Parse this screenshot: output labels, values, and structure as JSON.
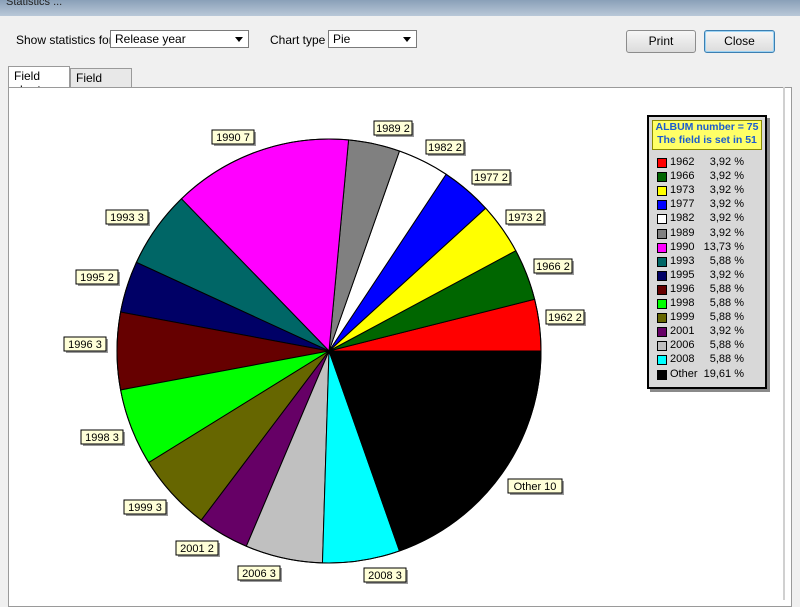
{
  "window": {
    "title": "Statistics ..."
  },
  "toolbar": {
    "show_label": "Show statistics for",
    "show_value": "Release year",
    "chart_type_label": "Chart type",
    "chart_type_value": "Pie",
    "print_label": "Print",
    "close_label": "Close"
  },
  "tabs": [
    {
      "label": "Field chart"
    },
    {
      "label": "Field data"
    }
  ],
  "legend": {
    "line1": "ALBUM number = 75",
    "line2": "The field is set in 51"
  },
  "chart_data": {
    "type": "pie",
    "start_angle_deg": 0,
    "slices": [
      {
        "label": "1962",
        "value": 2,
        "percent": "3,92 %",
        "color": "#ff0000"
      },
      {
        "label": "1966",
        "value": 2,
        "percent": "3,92 %",
        "color": "#006600"
      },
      {
        "label": "1973",
        "value": 2,
        "percent": "3,92 %",
        "color": "#ffff00"
      },
      {
        "label": "1977",
        "value": 2,
        "percent": "3,92 %",
        "color": "#0000ff"
      },
      {
        "label": "1982",
        "value": 2,
        "percent": "3,92 %",
        "color": "#ffffff"
      },
      {
        "label": "1989",
        "value": 2,
        "percent": "3,92 %",
        "color": "#808080"
      },
      {
        "label": "1990",
        "value": 7,
        "percent": "13,73 %",
        "color": "#ff00ff"
      },
      {
        "label": "1993",
        "value": 3,
        "percent": "5,88 %",
        "color": "#006666"
      },
      {
        "label": "1995",
        "value": 2,
        "percent": "3,92 %",
        "color": "#000066"
      },
      {
        "label": "1996",
        "value": 3,
        "percent": "5,88 %",
        "color": "#660000"
      },
      {
        "label": "1998",
        "value": 3,
        "percent": "5,88 %",
        "color": "#00ff00"
      },
      {
        "label": "1999",
        "value": 3,
        "percent": "5,88 %",
        "color": "#666600"
      },
      {
        "label": "2001",
        "value": 2,
        "percent": "3,92 %",
        "color": "#660066"
      },
      {
        "label": "2006",
        "value": 3,
        "percent": "5,88 %",
        "color": "#c0c0c0"
      },
      {
        "label": "2008",
        "value": 3,
        "percent": "5,88 %",
        "color": "#00ffff"
      },
      {
        "label": "Other",
        "value": 10,
        "percent": "19,61 %",
        "color": "#000000"
      }
    ],
    "labels": [
      {
        "text": "1962 2"
      },
      {
        "text": "1966 2"
      },
      {
        "text": "1973 2"
      },
      {
        "text": "1977 2"
      },
      {
        "text": "1982 2"
      },
      {
        "text": "1989 2"
      },
      {
        "text": "1990 7"
      },
      {
        "text": "1993 3"
      },
      {
        "text": "1995 2"
      },
      {
        "text": "1996 3"
      },
      {
        "text": "1998 3"
      },
      {
        "text": "1999 3"
      },
      {
        "text": "2001 2"
      },
      {
        "text": "2006 3"
      },
      {
        "text": "2008 3"
      },
      {
        "text": "Other  10"
      }
    ]
  }
}
